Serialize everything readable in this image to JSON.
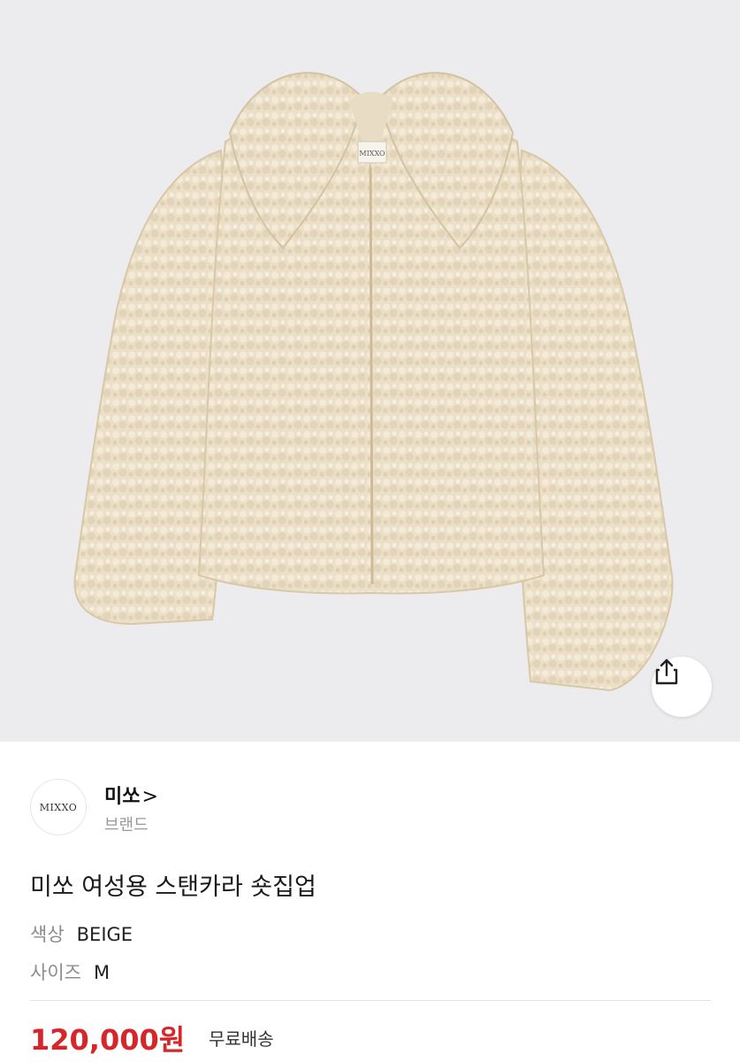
{
  "product": {
    "image_alt": "베이지 색상 스탠카라 숏집업 재킷",
    "label_text": "MIXXO",
    "share_icon": "share-icon"
  },
  "seller": {
    "logo_text": "MIXXO",
    "name": "미쏘",
    "chevron": ">",
    "subtitle": "브랜드"
  },
  "title": "미쏘 여성용 스탠카라 숏집업",
  "options": {
    "color_key": "색상",
    "color_value": "BEIGE",
    "size_key": "사이즈",
    "size_value": "M"
  },
  "price": {
    "amount": "120,000원",
    "shipping": "무료배송",
    "price_color": "#d7262a"
  },
  "colors": {
    "hero_bg": "#ecebed",
    "fur": "#ece0c9"
  }
}
